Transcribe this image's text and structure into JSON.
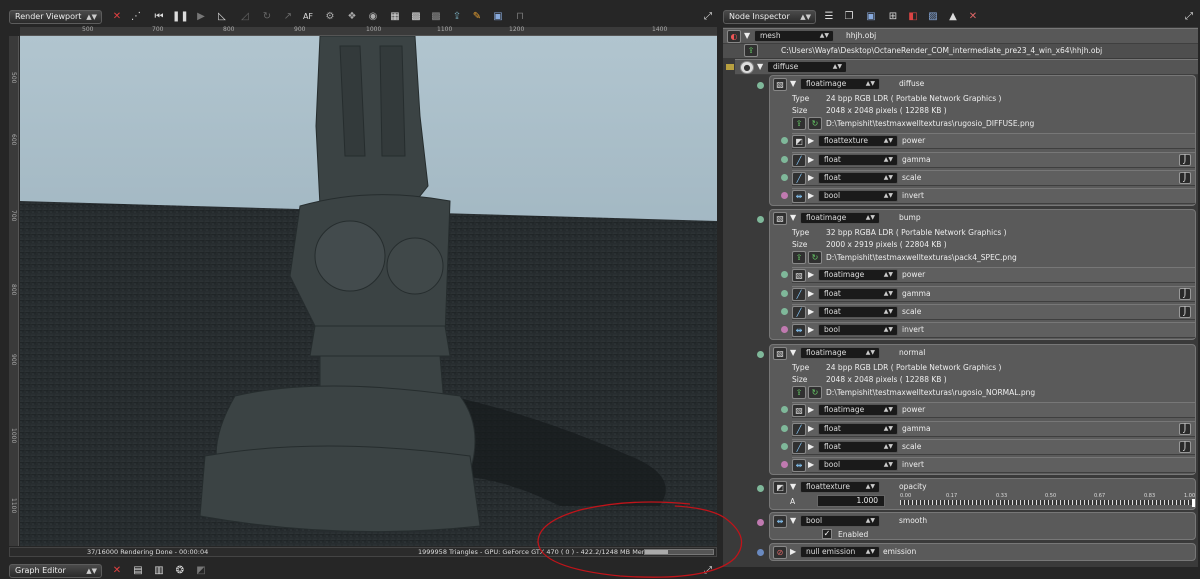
{
  "viewport": {
    "title": "Render Viewport",
    "toolbar_icons": [
      "reset-icon",
      "region-icon",
      "rewind-icon",
      "pause-icon",
      "play-icon",
      "focus-pick-icon",
      "ae-icon",
      "refresh-icon",
      "af-icon",
      "sphere-icon",
      "cube-icon",
      "grid-icon",
      "checker-icon",
      "export-icon",
      "pick-icon",
      "clay-icon",
      "lock-icon"
    ],
    "af_label": "AF",
    "ruler_top": [
      "500",
      "700",
      "800",
      "900",
      "1000",
      "1100",
      "1200",
      "1400"
    ],
    "ruler_left": [
      "500",
      "600",
      "700",
      "800",
      "900",
      "1000",
      "1100",
      "1200",
      "1300",
      "1400"
    ],
    "status_left": "37/16000 Rendering Done - 00:00:04",
    "status_right": "1999958 Triangles - GPU: GeForce GTX 470 ( 0 ) - 422.2/1248 MB Mem Used",
    "mem_fraction": 0.34,
    "colors": {
      "sky": "#a8bcc6",
      "ground": "#24292b",
      "statue": "#3a4243"
    }
  },
  "graph_editor": {
    "title": "Graph Editor"
  },
  "inspector": {
    "title": "Node Inspector",
    "mesh_type": "mesh",
    "mesh_name": "hhjh.obj",
    "mesh_path": "C:\\Users\\Wayfa\\Desktop\\OctaneRender_COM_intermediate_pre23_4_win_x64\\hhjh.obj",
    "material_type": "diffuse",
    "diffuse": {
      "type": "floatimage",
      "name": "diffuse",
      "type_label": "Type",
      "type_value": "24 bpp RGB LDR ( Portable Network Graphics )",
      "size_label": "Size",
      "size_value": "2048 x 2048 pixels ( 12288 KB )",
      "file": "D:\\Tempishit\\testmaxwelltexturas\\rugosio_DIFFUSE.png",
      "rows": [
        {
          "type": "floattexture",
          "name": "power"
        },
        {
          "type": "float",
          "name": "gamma"
        },
        {
          "type": "float",
          "name": "scale"
        },
        {
          "type": "bool",
          "name": "invert"
        }
      ]
    },
    "bump": {
      "type": "floatimage",
      "name": "bump",
      "type_label": "Type",
      "type_value": "32 bpp RGBA LDR ( Portable Network Graphics )",
      "size_label": "Size",
      "size_value": "2000 x 2919 pixels ( 22804 KB )",
      "file": "D:\\Tempishit\\testmaxwelltexturas\\pack4_SPEC.png",
      "rows": [
        {
          "type": "floatimage",
          "name": "power"
        },
        {
          "type": "float",
          "name": "gamma"
        },
        {
          "type": "float",
          "name": "scale"
        },
        {
          "type": "bool",
          "name": "invert"
        }
      ]
    },
    "normal": {
      "type": "floatimage",
      "name": "normal",
      "type_label": "Type",
      "type_value": "24 bpp RGB LDR ( Portable Network Graphics )",
      "size_label": "Size",
      "size_value": "2048 x 2048 pixels ( 12288 KB )",
      "file": "D:\\Tempishit\\testmaxwelltexturas\\rugosio_NORMAL.png",
      "rows": [
        {
          "type": "floatimage",
          "name": "power"
        },
        {
          "type": "float",
          "name": "gamma"
        },
        {
          "type": "float",
          "name": "scale"
        },
        {
          "type": "bool",
          "name": "invert"
        }
      ]
    },
    "opacity": {
      "type": "floattexture",
      "name": "opacity",
      "a_label": "A",
      "a_value": "1.000",
      "slider_fraction": 1.0,
      "ticks": [
        "0.00",
        "0.17",
        "0.33",
        "0.50",
        "0.67",
        "0.83",
        "1.00"
      ]
    },
    "smooth": {
      "type": "bool",
      "name": "smooth",
      "checkbox_label": "Enabled",
      "checked": true
    },
    "emission": {
      "type": "null emission",
      "name": "emission"
    }
  },
  "annotation": {
    "color": "#c0141a"
  }
}
